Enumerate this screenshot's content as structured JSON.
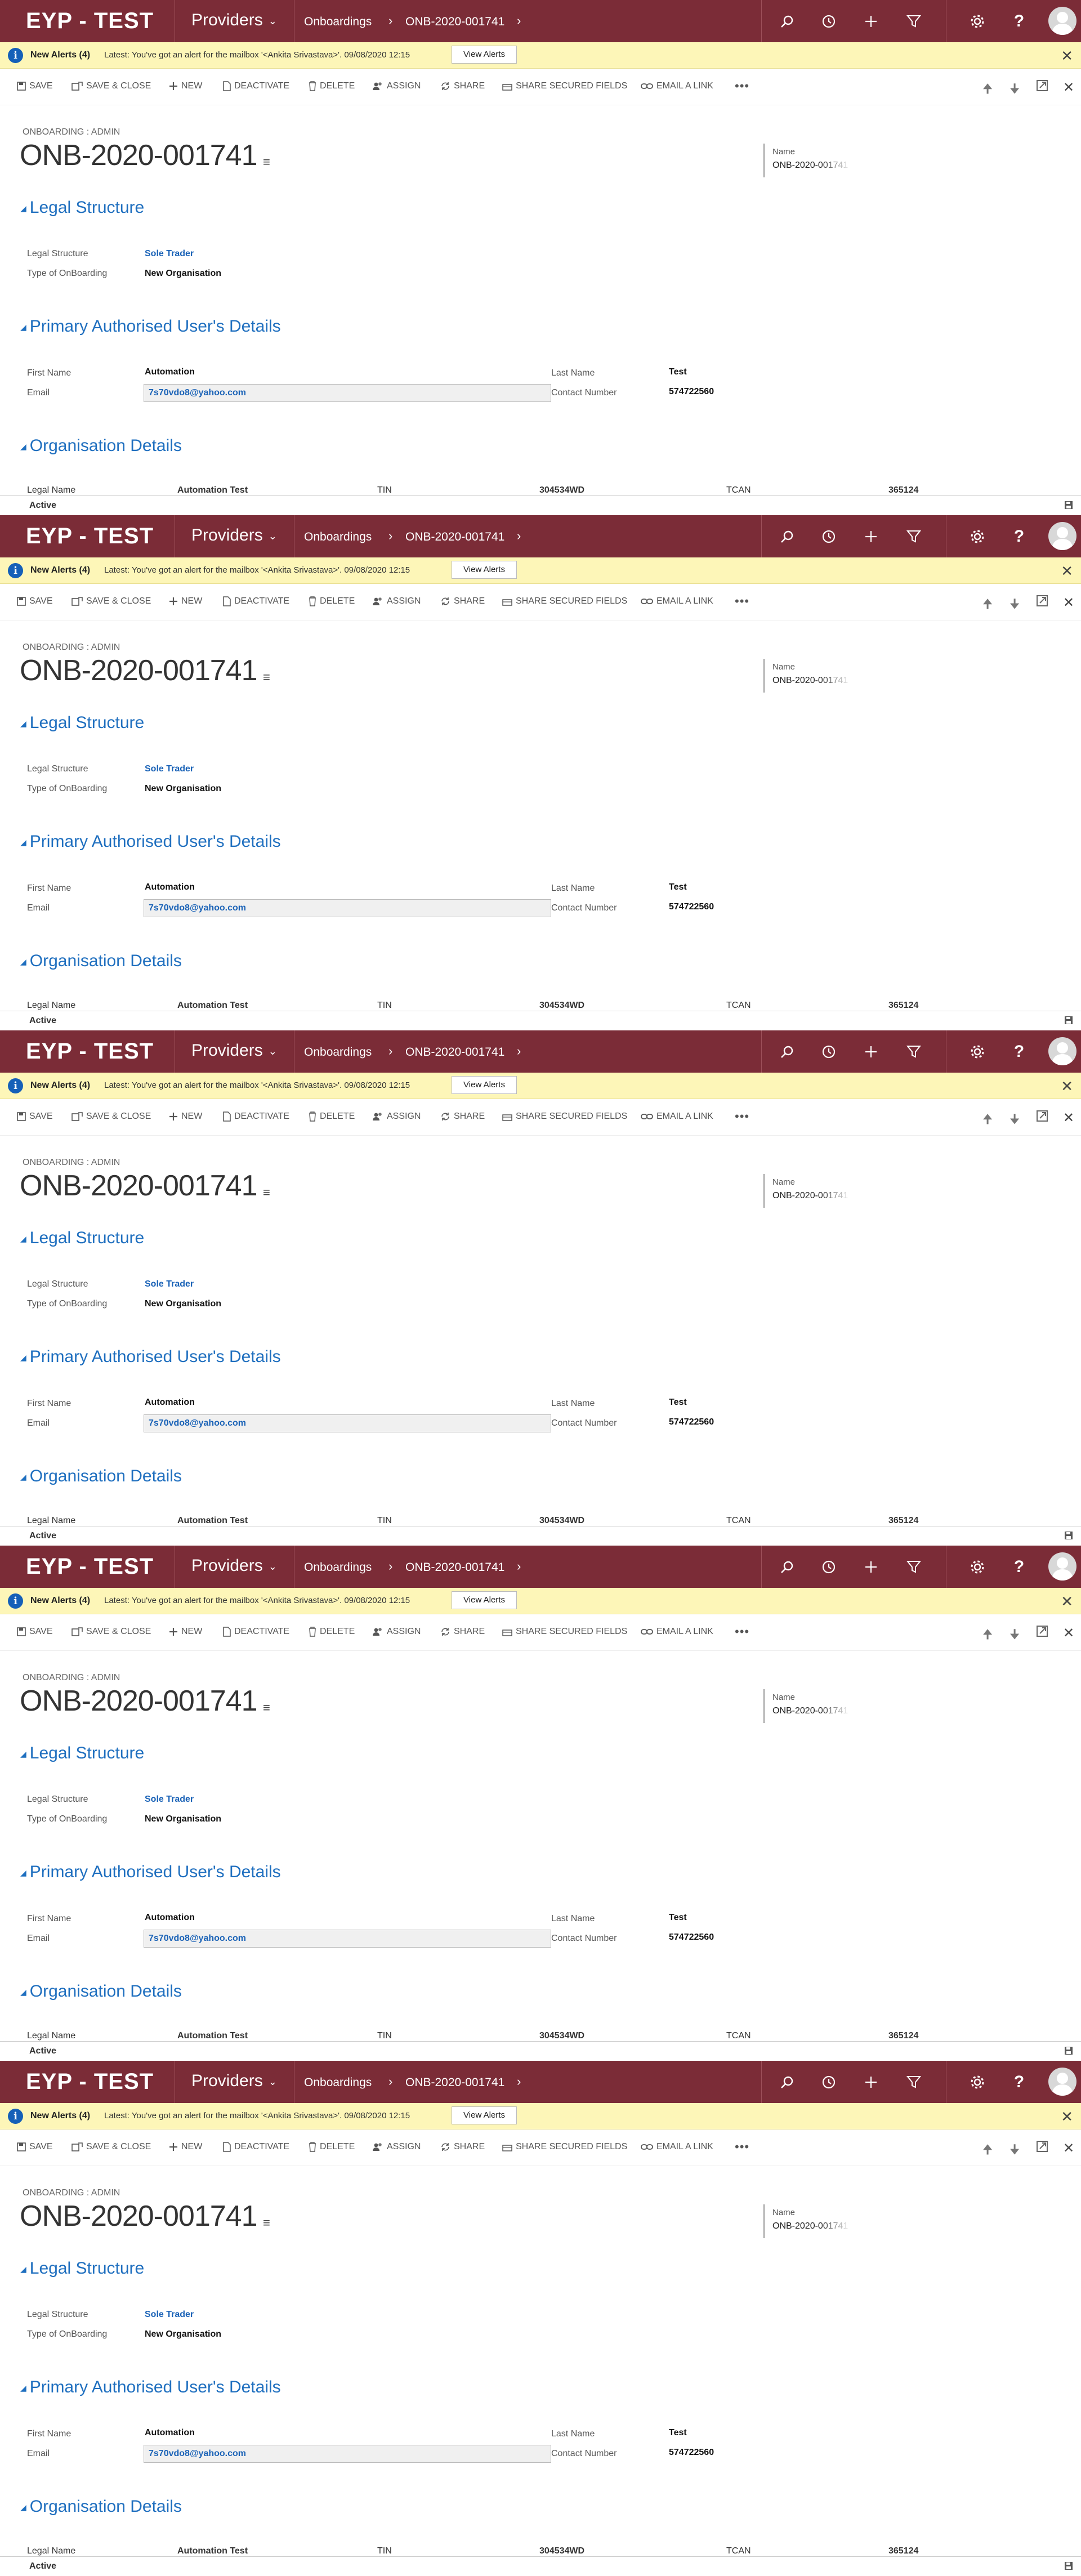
{
  "app": {
    "brand": "EYP - TEST",
    "area": "Providers",
    "breadcrumb": [
      "Onboardings",
      "ONB-2020-001741"
    ]
  },
  "alert": {
    "title": "New Alerts (4)",
    "message": "Latest: You've got an alert for the mailbox '<Ankita Srivastava>'. 09/08/2020 12:15",
    "button": "View Alerts"
  },
  "commands": [
    {
      "label": "SAVE",
      "icon": "save-icon"
    },
    {
      "label": "SAVE & CLOSE",
      "icon": "save-close-icon"
    },
    {
      "label": "NEW",
      "icon": "plus-icon"
    },
    {
      "label": "DEACTIVATE",
      "icon": "document-icon"
    },
    {
      "label": "DELETE",
      "icon": "trash-icon"
    },
    {
      "label": "ASSIGN",
      "icon": "users-icon"
    },
    {
      "label": "SHARE",
      "icon": "share-icon"
    },
    {
      "label": "SHARE SECURED FIELDS",
      "icon": "lock-share-icon"
    },
    {
      "label": "EMAIL A LINK",
      "icon": "link-icon"
    }
  ],
  "record": {
    "entity": "ONBOARDING : ADMIN",
    "title": "ONB-2020-001741",
    "header_field": {
      "label": "Name",
      "value": "ONB-2020-001741"
    }
  },
  "sections": {
    "legal": {
      "title": "Legal Structure",
      "fields": [
        {
          "label": "Legal Structure",
          "value": "Sole Trader"
        },
        {
          "label": "Type of OnBoarding",
          "value": "New Organisation"
        }
      ]
    },
    "user": {
      "title": "Primary Authorised User's Details",
      "first_name": {
        "label": "First Name",
        "value": "Automation"
      },
      "last_name": {
        "label": "Last Name",
        "value": "Test"
      },
      "email": {
        "label": "Email",
        "value": "7s70vdo8@yahoo.com"
      },
      "contact": {
        "label": "Contact Number",
        "value": "574722560"
      }
    },
    "org": {
      "title": "Organisation Details",
      "cut_row": [
        "Legal Name",
        "Automation Test",
        "TIN",
        "304534WD",
        "TCAN",
        "365124"
      ]
    }
  },
  "status": "Active",
  "colors": {
    "nav": "#7b2c37",
    "alert": "#fdf6b8",
    "section": "#1f6fbf"
  }
}
